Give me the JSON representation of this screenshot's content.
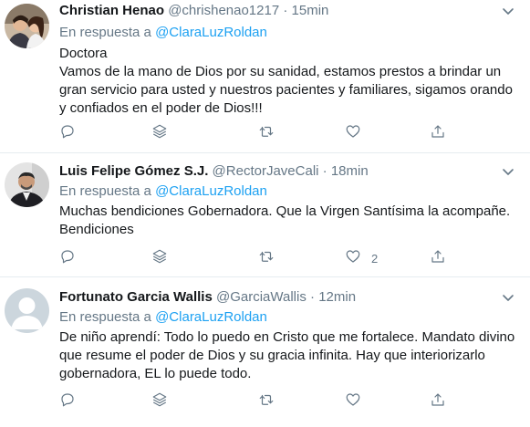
{
  "tweets": [
    {
      "name": "Christian Henao",
      "handle": "@chrishenao1217",
      "dot": "·",
      "time": "15min",
      "reply_prefix": "En respuesta a",
      "reply_to": "@ClaraLuzRoldan",
      "text": "Doctora\nVamos de la mano de Dios por su sanidad, estamos prestos a brindar un gran servicio para usted y nuestros pacientes y familiares, sigamos orando y confiados en el poder de Dios!!!",
      "like_count": ""
    },
    {
      "name": "Luis Felipe Gómez S.J.",
      "handle": "@RectorJaveCali",
      "dot": "·",
      "time": "18min",
      "reply_prefix": "En respuesta a",
      "reply_to": "@ClaraLuzRoldan",
      "text": "Muchas bendiciones Gobernadora. Que la Virgen Santísima la acompañe. Bendiciones",
      "like_count": "2"
    },
    {
      "name": "Fortunato Garcia Wallis",
      "handle": "@GarciaWallis",
      "dot": "·",
      "time": "12min",
      "reply_prefix": "En respuesta a",
      "reply_to": "@ClaraLuzRoldan",
      "text": "De niño aprendí: Todo lo puedo en Cristo que me fortalece. Mandato divino que resume el poder de Dios y su gracia infinita. Hay que interiorizarlo gobernadora, EL lo puede todo.",
      "like_count": ""
    }
  ],
  "icons": {
    "reply": "reply-icon",
    "stack": "stack-icon",
    "retweet": "retweet-icon",
    "like": "heart-icon",
    "share": "share-icon",
    "caret": "chevron-down-icon"
  },
  "colors": {
    "link": "#1da1f2",
    "secondary_text": "#657786",
    "divider": "#e6ecf0"
  }
}
